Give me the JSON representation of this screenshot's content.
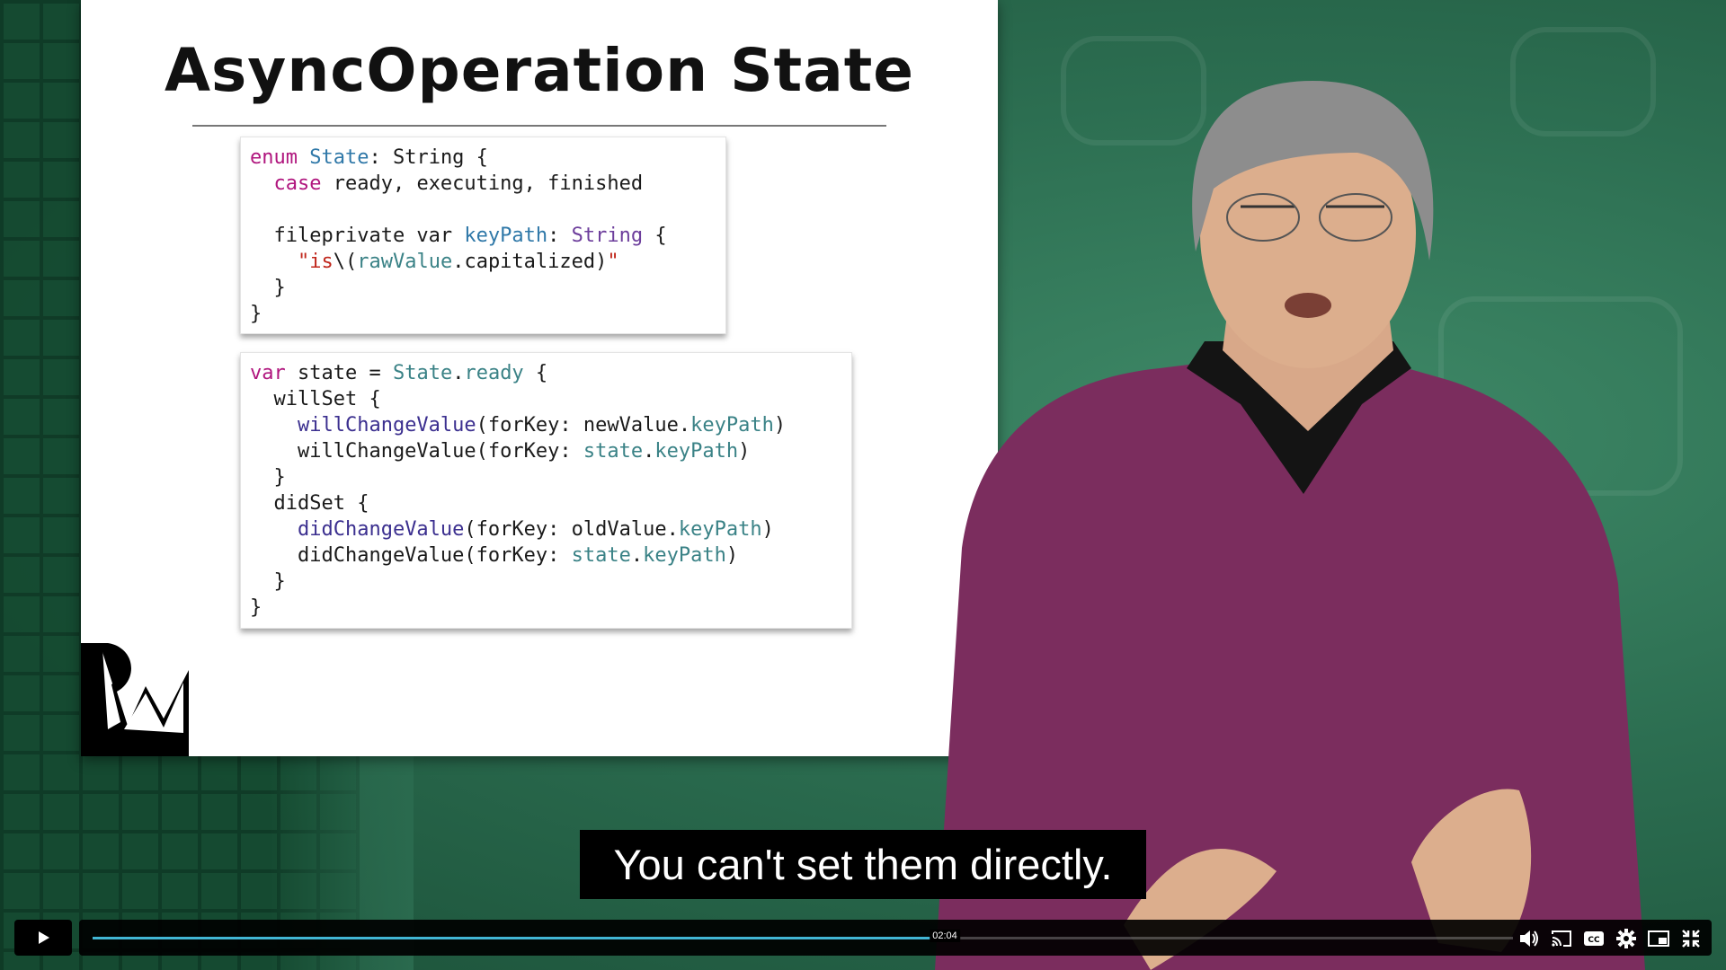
{
  "slide": {
    "title": "AsyncOperation State"
  },
  "code1": [
    [
      {
        "t": "enum ",
        "c": "kw"
      },
      {
        "t": "State",
        "c": "ty"
      },
      {
        "t": ": String {",
        "c": ""
      }
    ],
    [
      {
        "t": "  ",
        "c": ""
      },
      {
        "t": "case",
        "c": "kw"
      },
      {
        "t": " ready, executing, finished",
        "c": ""
      }
    ],
    [
      {
        "t": "",
        "c": ""
      }
    ],
    [
      {
        "t": "  fileprivate var ",
        "c": ""
      },
      {
        "t": "keyPath",
        "c": "ty"
      },
      {
        "t": ": ",
        "c": ""
      },
      {
        "t": "String",
        "c": "typ"
      },
      {
        "t": " {",
        "c": ""
      }
    ],
    [
      {
        "t": "    ",
        "c": ""
      },
      {
        "t": "\"is",
        "c": "str"
      },
      {
        "t": "\\(",
        "c": ""
      },
      {
        "t": "rawValue",
        "c": "vr"
      },
      {
        "t": ".capitalized)",
        "c": ""
      },
      {
        "t": "\"",
        "c": "str"
      }
    ],
    [
      {
        "t": "  }",
        "c": ""
      }
    ],
    [
      {
        "t": "}",
        "c": ""
      }
    ]
  ],
  "code2": [
    [
      {
        "t": "var",
        "c": "kw"
      },
      {
        "t": " state = ",
        "c": ""
      },
      {
        "t": "State",
        "c": "vr"
      },
      {
        "t": ".",
        "c": ""
      },
      {
        "t": "ready",
        "c": "vr"
      },
      {
        "t": " {",
        "c": ""
      }
    ],
    [
      {
        "t": "  willSet {",
        "c": ""
      }
    ],
    [
      {
        "t": "    ",
        "c": ""
      },
      {
        "t": "willChangeValue",
        "c": "mth"
      },
      {
        "t": "(forKey: newValue.",
        "c": ""
      },
      {
        "t": "keyPath",
        "c": "vr"
      },
      {
        "t": ")",
        "c": ""
      }
    ],
    [
      {
        "t": "    willChangeValue(forKey: ",
        "c": ""
      },
      {
        "t": "state",
        "c": "vr"
      },
      {
        "t": ".",
        "c": ""
      },
      {
        "t": "keyPath",
        "c": "vr"
      },
      {
        "t": ")",
        "c": ""
      }
    ],
    [
      {
        "t": "  }",
        "c": ""
      }
    ],
    [
      {
        "t": "  didSet {",
        "c": ""
      }
    ],
    [
      {
        "t": "    ",
        "c": ""
      },
      {
        "t": "didChangeValue",
        "c": "mth"
      },
      {
        "t": "(forKey: oldValue.",
        "c": ""
      },
      {
        "t": "keyPath",
        "c": "vr"
      },
      {
        "t": ")",
        "c": ""
      }
    ],
    [
      {
        "t": "    didChangeValue(forKey: ",
        "c": ""
      },
      {
        "t": "state",
        "c": "vr"
      },
      {
        "t": ".",
        "c": ""
      },
      {
        "t": "keyPath",
        "c": "vr"
      },
      {
        "t": ")",
        "c": ""
      }
    ],
    [
      {
        "t": "  }",
        "c": ""
      }
    ],
    [
      {
        "t": "}",
        "c": ""
      }
    ]
  ],
  "caption": "You can't set them directly.",
  "player": {
    "current_time": "02:04",
    "progress": 0.6,
    "accent_color": "#41b6d4",
    "controls": [
      "play-icon",
      "volume-icon",
      "cast-icon",
      "cc-icon",
      "settings-icon",
      "pip-icon",
      "exit-fullscreen-icon"
    ]
  }
}
